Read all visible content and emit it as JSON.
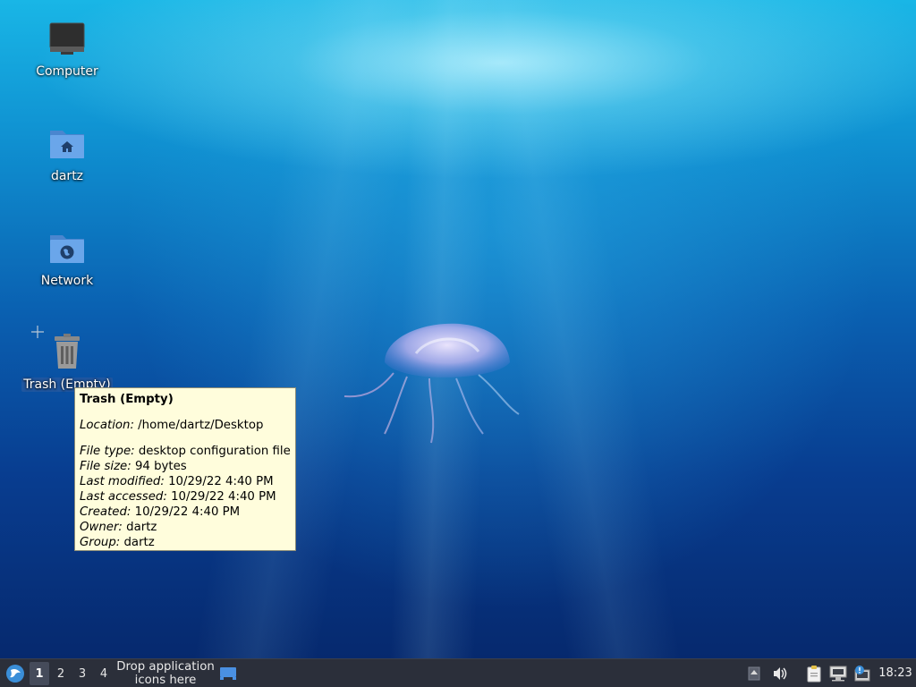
{
  "desktop": {
    "icons": [
      {
        "label": "Computer",
        "icon": "computer-icon"
      },
      {
        "label": "dartz",
        "icon": "home-folder-icon"
      },
      {
        "label": "Network",
        "icon": "network-folder-icon"
      },
      {
        "label": "Trash (Empty)",
        "icon": "trash-icon"
      }
    ]
  },
  "tooltip": {
    "title": "Trash (Empty)",
    "rows": [
      {
        "key": "Location:",
        "value": " /home/dartz/Desktop"
      },
      {
        "key": "File type:",
        "value": " desktop configuration file"
      },
      {
        "key": "File size:",
        "value": " 94 bytes"
      },
      {
        "key": "Last modified:",
        "value": " 10/29/22 4:40 PM"
      },
      {
        "key": "Last accessed:",
        "value": " 10/29/22 4:40 PM"
      },
      {
        "key": "Created:",
        "value": " 10/29/22 4:40 PM"
      },
      {
        "key": "Owner:",
        "value": " dartz"
      },
      {
        "key": "Group:",
        "value": " dartz"
      }
    ]
  },
  "taskbar": {
    "menu_icon": "lubuntu-menu-icon",
    "workspaces": [
      "1",
      "2",
      "3",
      "4"
    ],
    "active_workspace": "1",
    "launcher_line1": "Drop application",
    "launcher_line2": "icons here",
    "tray_icons": [
      "show-desktop-icon",
      "tray-up-arrow-icon",
      "volume-icon",
      "clipboard-icon",
      "network-icon",
      "update-notifier-icon"
    ],
    "clock": "18:23"
  },
  "colors": {
    "taskbar_bg": "#2b2f3a",
    "tooltip_bg": "#fffddc",
    "folder_blue": "#5d9ee6"
  }
}
